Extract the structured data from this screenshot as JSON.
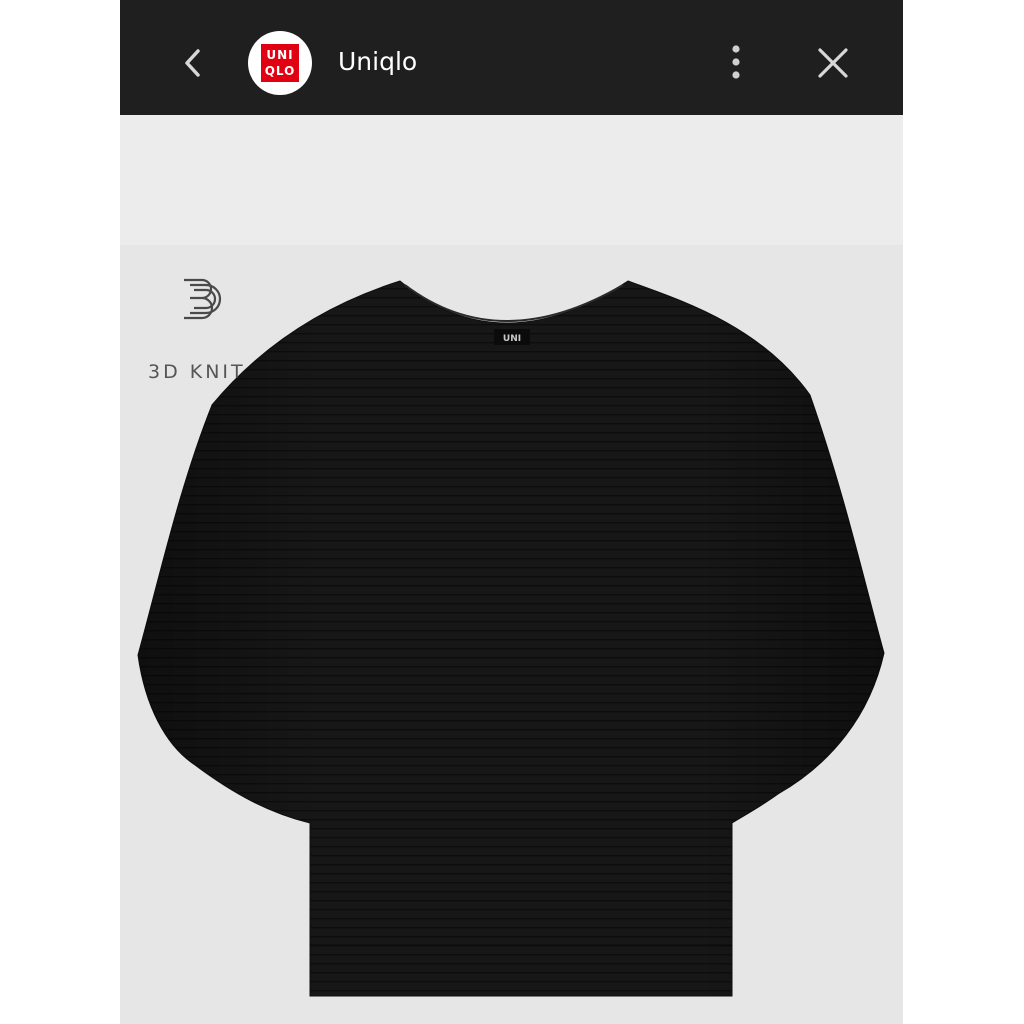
{
  "topbar": {
    "back_icon": "chevron-left-icon",
    "logo": {
      "brand_line_1": "UNI",
      "brand_line_2": "QLO",
      "brand_color": "#e00012"
    },
    "title": "Uniqlo",
    "menu_icon": "more-vertical-icon",
    "close_icon": "close-icon",
    "background_color": "#1f1f1f"
  },
  "product": {
    "badge_icon": "3d-knit-icon",
    "badge_label": "3D KNIT",
    "garment_color": "#161616",
    "neck_label_text": "UNI"
  }
}
